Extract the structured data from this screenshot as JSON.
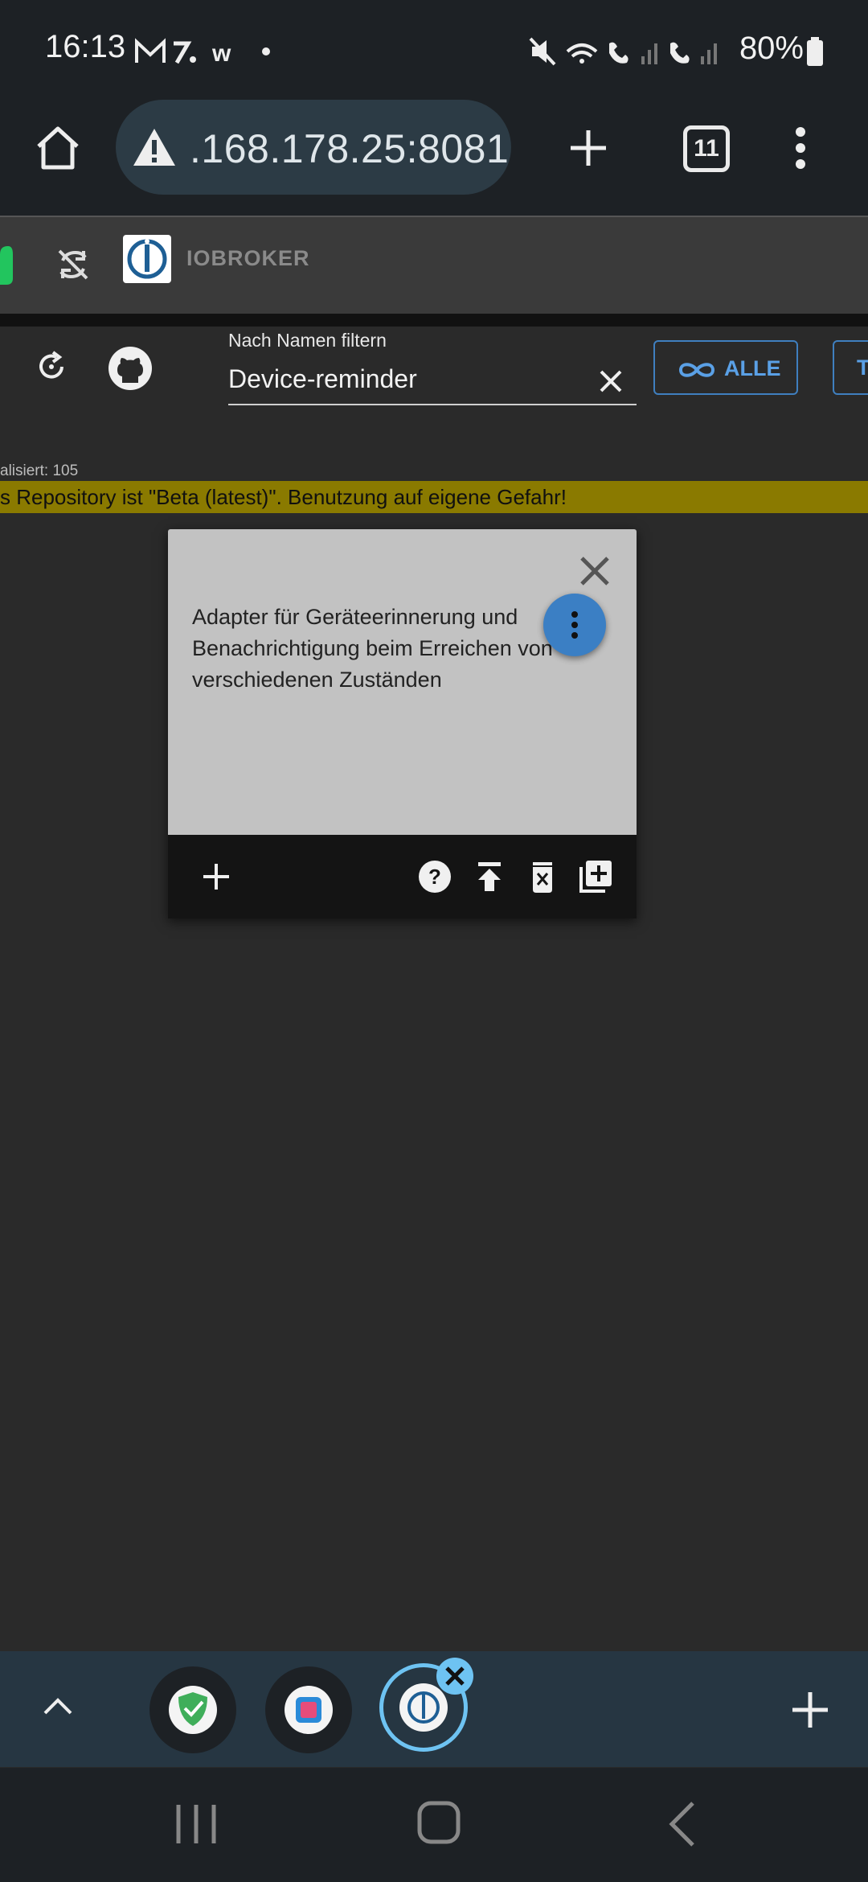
{
  "status_bar": {
    "time": "16:13",
    "battery": "80%"
  },
  "browser": {
    "url": ".168.178.25:8081",
    "tab_count": "11"
  },
  "app_header": {
    "brand": "IOBROKER"
  },
  "filter": {
    "label": "Nach Namen filtern",
    "value": "Device-reminder"
  },
  "toolbar": {
    "alle_label": "ALLE",
    "next_label": "T"
  },
  "info": {
    "counter": "alisiert: 105",
    "warning": "s Repository ist \"Beta (latest)\". Benutzung auf eigene Gefahr!"
  },
  "adapter_card": {
    "description": "Adapter für Geräteerinnerung und Benachrichtigung beim Erreichen von verschiedenen Zuständen"
  },
  "colors": {
    "accent": "#3b7fc4",
    "warning_bg": "#8a7a00",
    "online": "#22c55e"
  }
}
